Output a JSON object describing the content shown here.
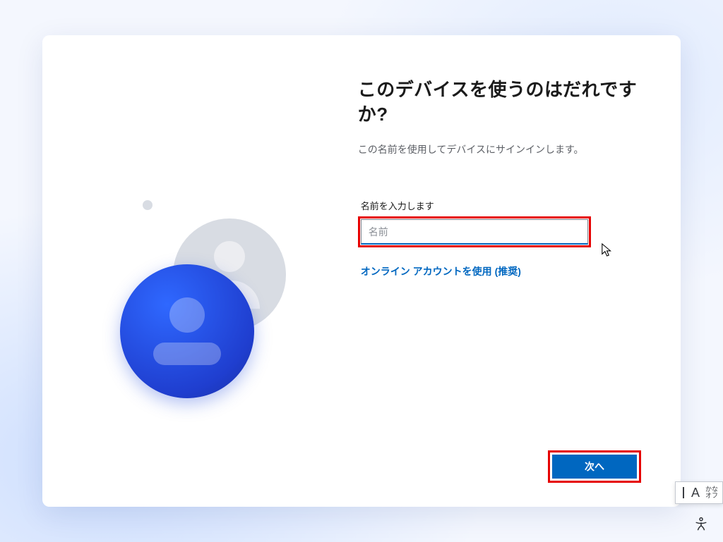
{
  "heading": "このデバイスを使うのはだれですか?",
  "subtitle": "この名前を使用してデバイスにサインインします。",
  "field": {
    "label": "名前を入力します",
    "placeholder": "名前",
    "value": ""
  },
  "link": "オンライン アカウントを使用 (推奨)",
  "buttons": {
    "next": "次へ"
  },
  "ime": {
    "mode": "A",
    "line1": "かな",
    "line2": "オフ"
  }
}
